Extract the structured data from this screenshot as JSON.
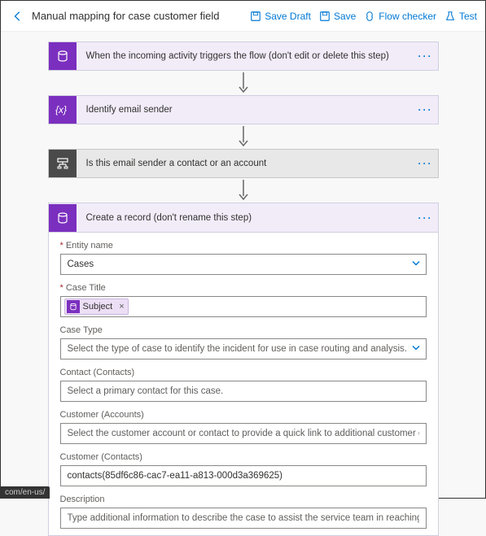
{
  "header": {
    "title": "Manual mapping for case customer field",
    "save_draft": "Save Draft",
    "save": "Save",
    "flow_checker": "Flow checker",
    "test": "Test"
  },
  "steps": {
    "trigger": "When the incoming activity triggers the flow (don't edit or delete this step)",
    "identify": "Identify email sender",
    "condition": "Is this email sender a contact or an account",
    "create": "Create a record (don't rename this step)"
  },
  "form": {
    "entity_name_label": "Entity name",
    "entity_name_value": "Cases",
    "case_title_label": "Case Title",
    "subject_token": "Subject",
    "case_type_label": "Case Type",
    "case_type_placeholder": "Select the type of case to identify the incident for use in case routing and analysis.",
    "contact_label": "Contact (Contacts)",
    "contact_placeholder": "Select a primary contact for this case.",
    "customer_acc_label": "Customer (Accounts)",
    "customer_acc_placeholder": "Select the customer account or contact to provide a quick link to additional customer details, such as ac",
    "customer_con_label": "Customer (Contacts)",
    "customer_con_value": "contacts(85df6c86-cac7-ea11-a813-000d3a369625)",
    "description_label": "Description",
    "description_placeholder": "Type additional information to describe the case to assist the service team in reaching a resolution."
  },
  "footer_status": "com/en-us/"
}
